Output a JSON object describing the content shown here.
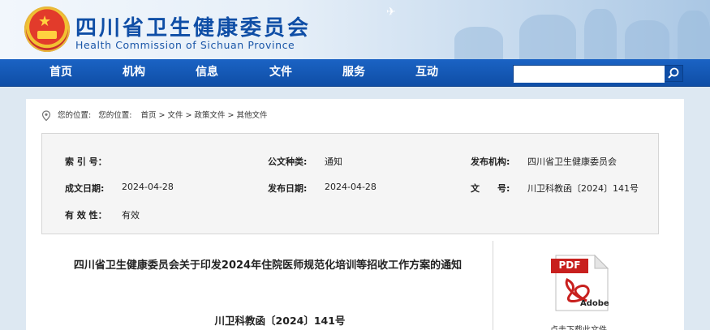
{
  "header": {
    "title": "四川省卫生健康委员会",
    "subtitle": "Health Commission of Sichuan Province"
  },
  "nav": {
    "items": [
      "首页",
      "机构",
      "信息",
      "文件",
      "服务",
      "互动"
    ]
  },
  "search": {
    "value": "",
    "placeholder": ""
  },
  "breadcrumb": {
    "prefix1": "您的位置:",
    "prefix2": "您的位置:",
    "path": "首页 > 文件 > 政策文件 > 其他文件"
  },
  "meta": {
    "index_label": "索 引 号：",
    "index_value": "",
    "doc_type_label": "公文种类:",
    "doc_type_value": "通知",
    "publisher_label": "发布机构:",
    "publisher_value": "四川省卫生健康委员会",
    "created_label": "成文日期:",
    "created_value": "2024-04-28",
    "published_label": "发布日期:",
    "published_value": "2024-04-28",
    "docno_label": "文　　号:",
    "docno_value": "川卫科教函〔2024〕141号",
    "validity_label": "有 效 性：",
    "validity_value": "有效"
  },
  "article": {
    "title": "四川省卫生健康委员会关于印发2024年住院医师规范化培训等招收工作方案的通知",
    "doc_number": "川卫科教函〔2024〕141号"
  },
  "attachment": {
    "badge": "PDF",
    "brand": "Adobe",
    "download_label": "点击下载此文件"
  },
  "colors": {
    "nav_blue": "#0f4ea6",
    "title_blue": "#0f4ea6",
    "pdf_red": "#c8201e"
  }
}
